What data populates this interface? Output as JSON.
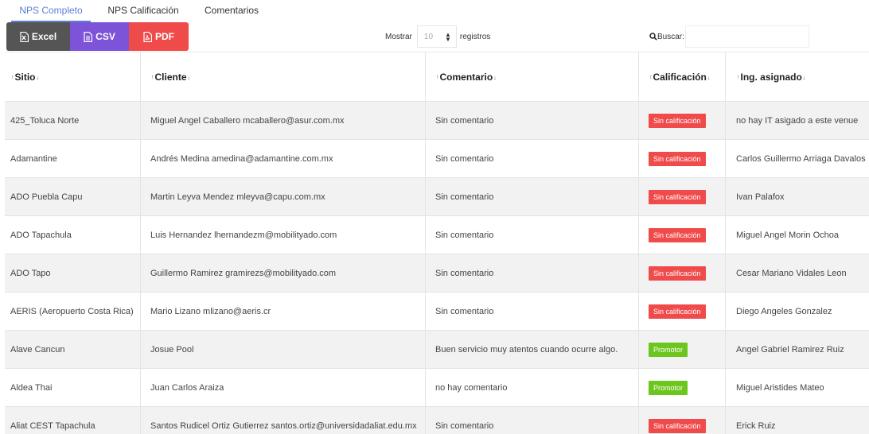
{
  "tabs": [
    {
      "label": "NPS Completo",
      "active": true
    },
    {
      "label": "NPS Calificación",
      "active": false
    },
    {
      "label": "Comentarios",
      "active": false
    }
  ],
  "toolbar": {
    "excel_label": "Excel",
    "csv_label": "CSV",
    "pdf_label": "PDF",
    "show_label": "Mostrar",
    "page_size": "10",
    "records_label": "registros",
    "search_label": "Buscar:",
    "search_value": ""
  },
  "colors": {
    "tab_active": "#5b7fd6",
    "excel": "#555555",
    "csv": "#7d54d8",
    "pdf": "#f04b4b",
    "badge_detractor": "#f04b4b",
    "badge_promotor": "#6cc61e"
  },
  "table": {
    "columns": [
      "Sitio",
      "Cliente",
      "Comentario",
      "Calificación",
      "Ing. asignado"
    ],
    "rows": [
      {
        "sitio": "425_Toluca Norte",
        "cliente": "Miguel Angel Caballero mcaballero@asur.com.mx",
        "comentario": "Sin comentario",
        "calificacion": "Sin calificación",
        "tipo": "detractor",
        "ingeniero": "no hay IT asigado a este venue"
      },
      {
        "sitio": "Adamantine",
        "cliente": "Andrés Medina amedina@adamantine.com.mx",
        "comentario": "Sin comentario",
        "calificacion": "Sin calificación",
        "tipo": "detractor",
        "ingeniero": "Carlos Guillermo Arriaga Davalos"
      },
      {
        "sitio": "ADO Puebla Capu",
        "cliente": "Martin Leyva Mendez mleyva@capu.com.mx",
        "comentario": "Sin comentario",
        "calificacion": "Sin calificación",
        "tipo": "detractor",
        "ingeniero": "Ivan Palafox"
      },
      {
        "sitio": "ADO Tapachula",
        "cliente": "Luis Hernandez lhernandezm@mobilityado.com",
        "comentario": "Sin comentario",
        "calificacion": "Sin calificación",
        "tipo": "detractor",
        "ingeniero": "Miguel Angel Morin Ochoa"
      },
      {
        "sitio": "ADO Tapo",
        "cliente": "Guillermo Ramirez gramirezs@mobilityado.com",
        "comentario": "Sin comentario",
        "calificacion": "Sin calificación",
        "tipo": "detractor",
        "ingeniero": "Cesar Mariano Vidales Leon"
      },
      {
        "sitio": "AERIS (Aeropuerto Costa Rica)",
        "cliente": "Mario Lizano mlizano@aeris.cr",
        "comentario": "Sin comentario",
        "calificacion": "Sin calificación",
        "tipo": "detractor",
        "ingeniero": "Diego Angeles Gonzalez"
      },
      {
        "sitio": "Alave Cancun",
        "cliente": "Josue Pool",
        "comentario": "Buen servicio muy atentos cuando ocurre algo.",
        "calificacion": "Promotor",
        "tipo": "promotor",
        "ingeniero": "Angel Gabriel Ramirez Ruiz"
      },
      {
        "sitio": "Aldea Thai",
        "cliente": "Juan Carlos Araiza",
        "comentario": "no hay comentario",
        "calificacion": "Promotor",
        "tipo": "promotor",
        "ingeniero": "Miguel Aristides Mateo"
      },
      {
        "sitio": "Aliat CEST Tapachula",
        "cliente": "Santos Rudicel Ortiz Gutierrez santos.ortiz@universidadaliat.edu.mx",
        "comentario": "Sin comentario",
        "calificacion": "Sin calificación",
        "tipo": "detractor",
        "ingeniero": "Erick Ruiz"
      }
    ]
  }
}
